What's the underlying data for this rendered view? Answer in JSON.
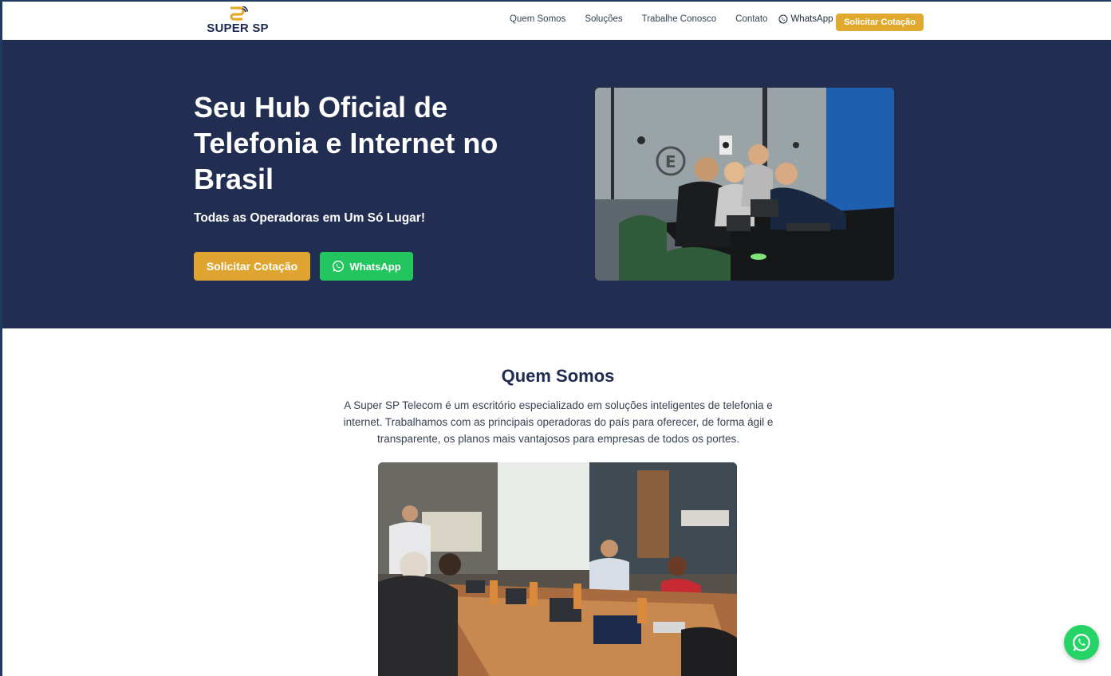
{
  "brand": {
    "logo_text": "SUPER SP",
    "logo_mark": "SP"
  },
  "nav": {
    "links": [
      "Quem Somos",
      "Soluções",
      "Trabalhe Conosco",
      "Contato"
    ],
    "whatsapp_label": "WhatsApp",
    "cta_label": "Solicitar Cotação"
  },
  "hero": {
    "title": "Seu Hub Oficial de Telefonia e Internet no Brasil",
    "subtitle": "Todas as Operadoras em Um Só Lugar!",
    "primary_button": "Solicitar Cotação",
    "whatsapp_button": "WhatsApp"
  },
  "about": {
    "title": "Quem Somos",
    "text": "A Super SP Telecom é um escritório especializado em soluções inteligentes de telefonia e internet. Trabalhamos com as principais operadoras do país para oferecer, de forma ágil e transparente, os planos mais vantajosos para empresas de todos os portes."
  },
  "colors": {
    "navy": "#222d52",
    "gold": "#dfa530",
    "whatsapp_green": "#22c55e",
    "title_navy": "#1e2a52"
  },
  "icons": {
    "whatsapp": "whatsapp-icon",
    "float": "whatsapp-float-icon"
  }
}
